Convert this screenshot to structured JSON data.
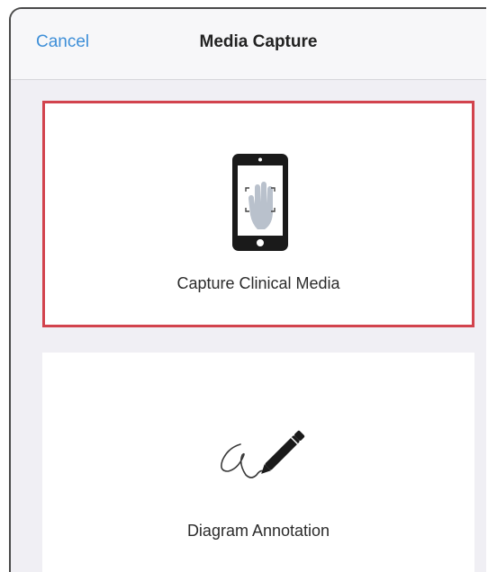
{
  "header": {
    "cancel_label": "Cancel",
    "title": "Media Capture"
  },
  "options": [
    {
      "label": "Capture Clinical Media",
      "icon": "tablet-camera-icon",
      "selected": true,
      "highlight_color": "#d2434d"
    },
    {
      "label": "Diagram Annotation",
      "icon": "pen-signature-icon",
      "selected": false
    }
  ],
  "colors": {
    "accent": "#3e8fd8",
    "background": "#f0eff4"
  }
}
